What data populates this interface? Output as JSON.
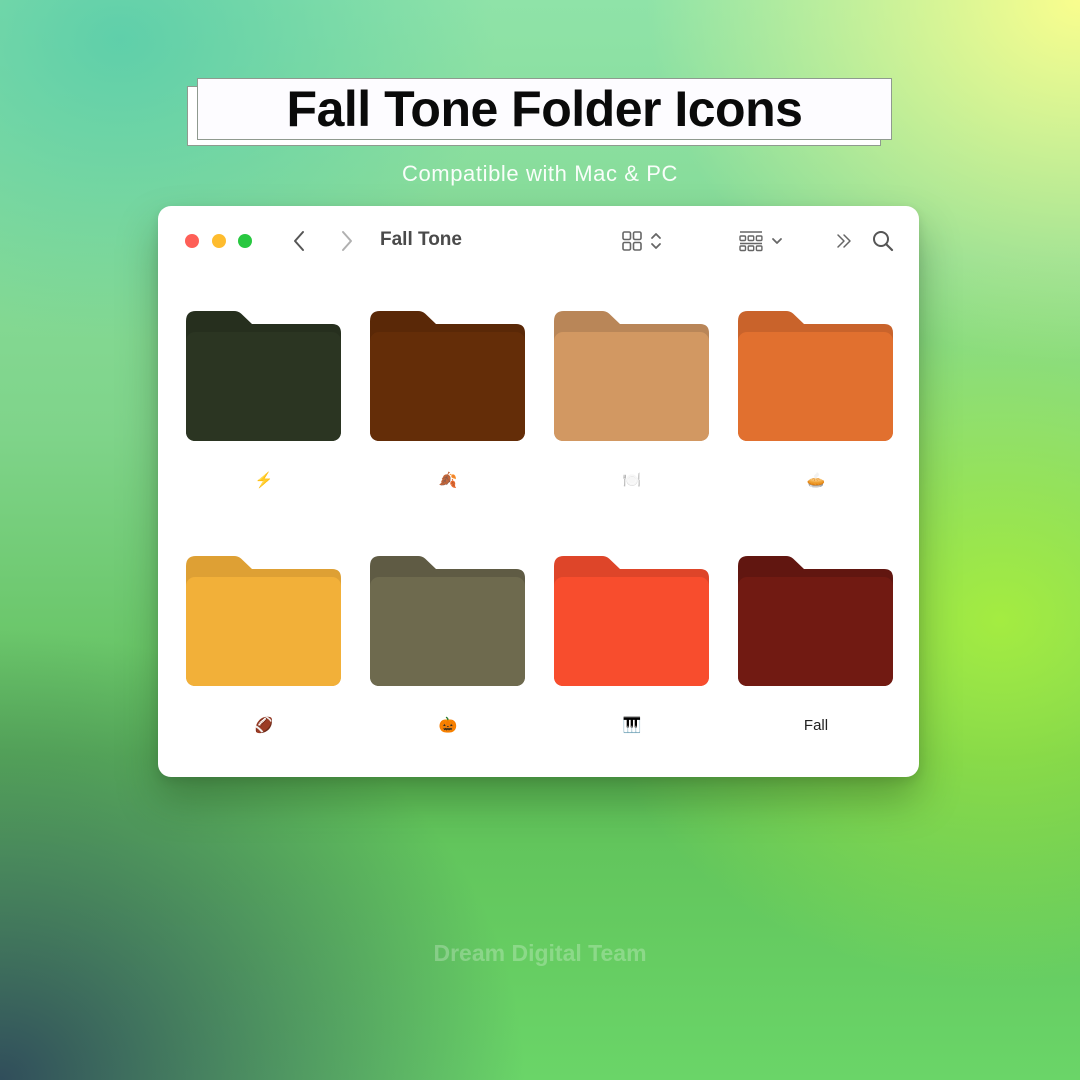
{
  "header": {
    "title": "Fall Tone Folder Icons",
    "subtitle": "Compatible with Mac & PC"
  },
  "window": {
    "title": "Fall Tone",
    "controls": {
      "close_color": "#fe5f57",
      "minimize_color": "#febc2e",
      "zoom_color": "#28c840"
    },
    "toolbar": {
      "back_icon": "chevron-left-icon",
      "forward_icon": "chevron-right-icon",
      "view_icon": "grid-view-icon",
      "group_icon": "group-by-icon",
      "more_icon": "double-chevron-right-icon",
      "search_icon": "search-icon"
    },
    "folders": [
      {
        "label": "⚡",
        "color": "#2b3522",
        "tab_color": "#262f1e"
      },
      {
        "label": "🍂",
        "color": "#642d08",
        "tab_color": "#5a2807"
      },
      {
        "label": "🍽️",
        "color": "#d29862",
        "tab_color": "#b98658"
      },
      {
        "label": "🥧",
        "color": "#e1702f",
        "tab_color": "#c9632b"
      },
      {
        "label": "🏈",
        "color": "#f2b039",
        "tab_color": "#dea034"
      },
      {
        "label": "🎃",
        "color": "#6e6a4e",
        "tab_color": "#5f5b44"
      },
      {
        "label": "🎹",
        "color": "#f84d2d",
        "tab_color": "#de4529"
      },
      {
        "label": "Fall",
        "color": "#711a12",
        "tab_color": "#611610"
      }
    ]
  },
  "footer": {
    "credit": "Dream Digital Team"
  }
}
